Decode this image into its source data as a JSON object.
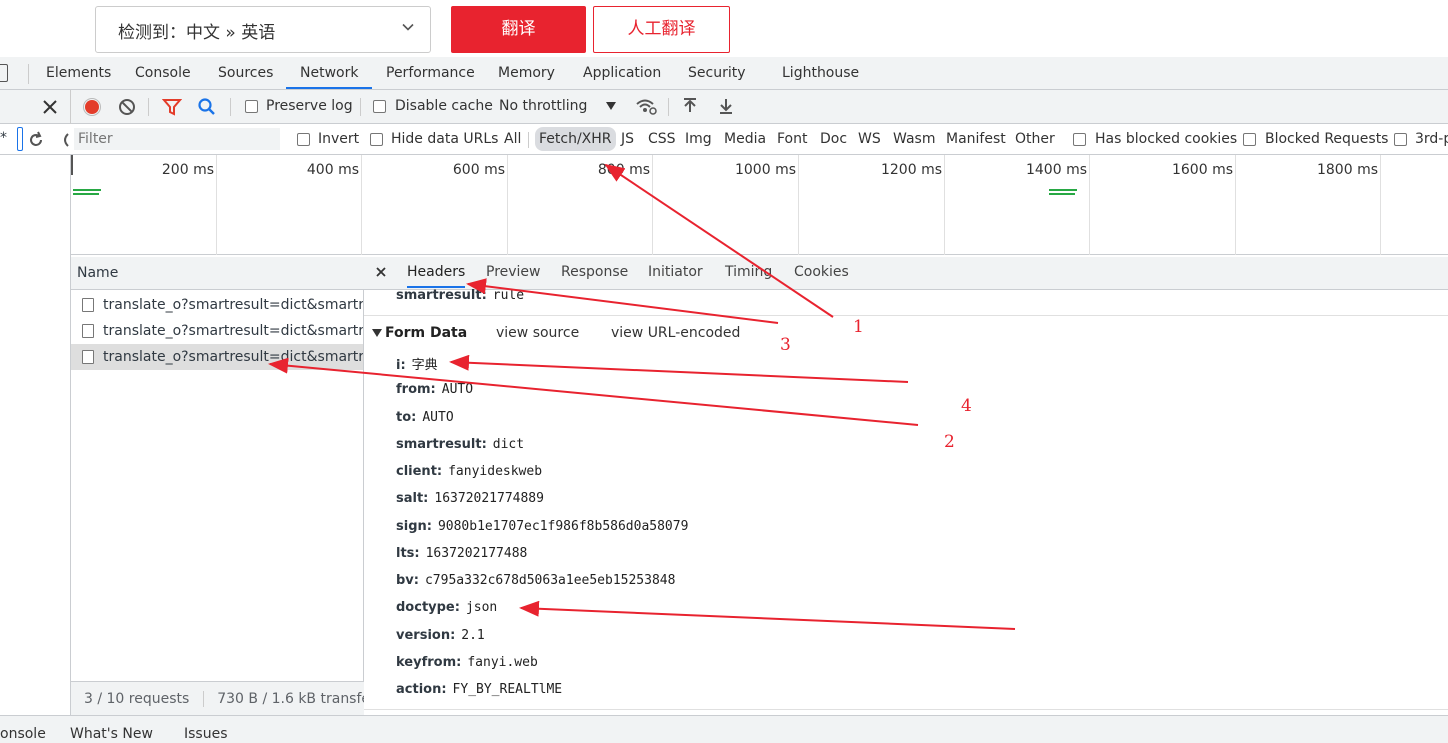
{
  "page": {
    "lang_select": "检测到：中文 » 英语",
    "translate_button": "翻译",
    "human_translate_button": "人工翻译"
  },
  "devtools": {
    "tabs": [
      "Elements",
      "Console",
      "Sources",
      "Network",
      "Performance",
      "Memory",
      "Application",
      "Security",
      "Lighthouse"
    ],
    "active_tab": "Network"
  },
  "toolbar": {
    "preserve_log": "Preserve log",
    "disable_cache": "Disable cache",
    "throttling": "No throttling"
  },
  "filterbar": {
    "placeholder": "Filter",
    "invert": "Invert",
    "hide_data_urls": "Hide data URLs",
    "types": [
      "All",
      "Fetch/XHR",
      "JS",
      "CSS",
      "Img",
      "Media",
      "Font",
      "Doc",
      "WS",
      "Wasm",
      "Manifest",
      "Other"
    ],
    "active_type": "Fetch/XHR",
    "has_blocked_cookies": "Has blocked cookies",
    "blocked_requests": "Blocked Requests",
    "third_party": "3rd-p"
  },
  "timeline": {
    "ticks": [
      "200 ms",
      "400 ms",
      "600 ms",
      "800 ms",
      "1000 ms",
      "1200 ms",
      "1400 ms",
      "1600 ms",
      "1800 ms"
    ]
  },
  "requests": {
    "header": "Name",
    "rows": [
      "translate_o?smartresult=dict&smartr...",
      "translate_o?smartresult=dict&smartr...",
      "translate_o?smartresult=dict&smartr..."
    ],
    "footer_count": "3 / 10 requests",
    "footer_size": "730 B / 1.6 kB transferr"
  },
  "detail": {
    "tabs": [
      "Headers",
      "Preview",
      "Response",
      "Initiator",
      "Timing",
      "Cookies"
    ],
    "active_tab": "Headers",
    "partial_row": {
      "key": "smartresult:",
      "value": "rule"
    },
    "form_data_title": "Form Data",
    "view_source": "view source",
    "view_url_encoded": "view URL-encoded",
    "form": [
      {
        "key": "i:",
        "value": "字典"
      },
      {
        "key": "from:",
        "value": "AUTO"
      },
      {
        "key": "to:",
        "value": "AUTO"
      },
      {
        "key": "smartresult:",
        "value": "dict"
      },
      {
        "key": "client:",
        "value": "fanyideskweb"
      },
      {
        "key": "salt:",
        "value": "16372021774889"
      },
      {
        "key": "sign:",
        "value": "9080b1e1707ec1f986f8b586d0a58079"
      },
      {
        "key": "lts:",
        "value": "1637202177488"
      },
      {
        "key": "bv:",
        "value": "c795a332c678d5063a1ee5eb15253848"
      },
      {
        "key": "doctype:",
        "value": "json"
      },
      {
        "key": "version:",
        "value": "2.1"
      },
      {
        "key": "keyfrom:",
        "value": "fanyi.web"
      },
      {
        "key": "action:",
        "value": "FY_BY_REALTlME"
      }
    ]
  },
  "drawer": {
    "tabs": [
      "onsole",
      "What's New",
      "Issues"
    ]
  },
  "annotations": {
    "labels": [
      "1",
      "2",
      "3",
      "4"
    ],
    "color": "#e8232f"
  }
}
